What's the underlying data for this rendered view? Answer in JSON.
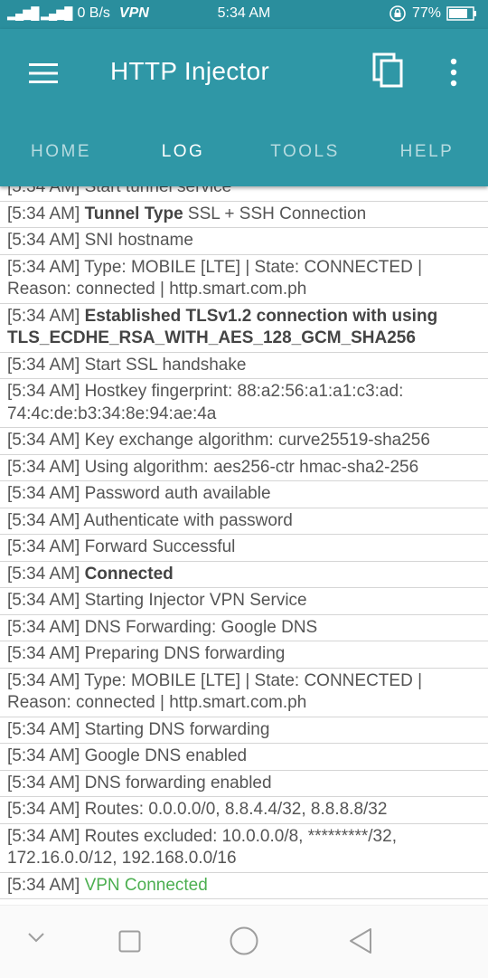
{
  "status_bar": {
    "network_speed": "0 B/s",
    "vpn_label": "VPN",
    "time": "5:34 AM",
    "battery": "77%"
  },
  "app_bar": {
    "title": "HTTP Injector"
  },
  "tabs": [
    {
      "label": "HOME",
      "active": false
    },
    {
      "label": "LOG",
      "active": true
    },
    {
      "label": "TOOLS",
      "active": false
    },
    {
      "label": "HELP",
      "active": false
    }
  ],
  "log": [
    {
      "time": "[5:34 AM]",
      "bold": "",
      "text": "Start tunnel service"
    },
    {
      "time": "[5:34 AM]",
      "bold": "Tunnel Type",
      "text": "SSL + SSH Connection"
    },
    {
      "time": "[5:34 AM]",
      "bold": "",
      "text": "SNI hostname"
    },
    {
      "time": "[5:34 AM]",
      "bold": "",
      "text": "Type: MOBILE [LTE] | State: CONNECTED | Reason: connected | http.smart.com.ph"
    },
    {
      "time": "[5:34 AM]",
      "bold": "Established TLSv1.2 connection with using TLS_ECDHE_RSA_WITH_AES_128_GCM_SHA256",
      "text": ""
    },
    {
      "time": "[5:34 AM]",
      "bold": "",
      "text": "Start SSL handshake"
    },
    {
      "time": "[5:34 AM]",
      "bold": "",
      "text": "Hostkey fingerprint: 88:a2:56:a1:a1:c3:ad: 74:4c:de:b3:34:8e:94:ae:4a"
    },
    {
      "time": "[5:34 AM]",
      "bold": "",
      "text": "Key exchange algorithm: curve25519-sha256"
    },
    {
      "time": "[5:34 AM]",
      "bold": "",
      "text": "Using algorithm: aes256-ctr hmac-sha2-256"
    },
    {
      "time": "[5:34 AM]",
      "bold": "",
      "text": "Password auth available"
    },
    {
      "time": "[5:34 AM]",
      "bold": "",
      "text": "Authenticate with password"
    },
    {
      "time": "[5:34 AM]",
      "bold": "",
      "text": "Forward Successful"
    },
    {
      "time": "[5:34 AM]",
      "bold": "Connected",
      "text": ""
    },
    {
      "time": "[5:34 AM]",
      "bold": "",
      "text": "Starting Injector VPN Service"
    },
    {
      "time": "[5:34 AM]",
      "bold": "",
      "text": "DNS Forwarding: Google DNS"
    },
    {
      "time": "[5:34 AM]",
      "bold": "",
      "text": "Preparing DNS forwarding"
    },
    {
      "time": "[5:34 AM]",
      "bold": "",
      "text": "Type: MOBILE [LTE] | State: CONNECTED | Reason: connected | http.smart.com.ph"
    },
    {
      "time": "[5:34 AM]",
      "bold": "",
      "text": "Starting DNS forwarding"
    },
    {
      "time": "[5:34 AM]",
      "bold": "",
      "text": "Google DNS enabled"
    },
    {
      "time": "[5:34 AM]",
      "bold": "",
      "text": "DNS forwarding enabled"
    },
    {
      "time": "[5:34 AM]",
      "bold": "",
      "text": "Routes: 0.0.0.0/0, 8.8.4.4/32, 8.8.8.8/32"
    },
    {
      "time": "[5:34 AM]",
      "bold": "",
      "text": "Routes excluded: 10.0.0.0/8, *********/32, 172.16.0.0/12, 192.168.0.0/16"
    },
    {
      "time": "[5:34 AM]",
      "bold": "",
      "text": "",
      "green": "VPN Connected"
    }
  ],
  "colors": {
    "status_bar_bg": "#2a8e9d",
    "app_bar_bg": "#2f97a6",
    "log_text": "#555555",
    "success_green": "#4caf50"
  }
}
